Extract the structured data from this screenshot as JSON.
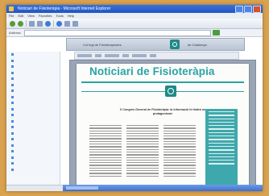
{
  "window": {
    "title": "Noticiari de Fisioteràpia - Microsoft Internet Explorer"
  },
  "menu": [
    "File",
    "Edit",
    "View",
    "Favorites",
    "Tools",
    "Help"
  ],
  "address": {
    "label": "Address"
  },
  "site_banner": {
    "left_text": "Col·legi de Fisioterapeutes",
    "right_text": "de Catalunya"
  },
  "sidebar": {
    "item_count_visible": 20,
    "accent": "#2d5aa8"
  },
  "newsletter": {
    "masthead": "Noticiari de Fisioteràpia",
    "headline": "X Congrés General de Fisioteràpia: la informació hi tindrà un protagonisme",
    "accent": "#2aa3a6"
  },
  "colors": {
    "background": "#d9a24f",
    "titlebar": "#1f55c2",
    "teal": "#2aa3a6"
  },
  "icons": [
    "browser-icon",
    "back-icon",
    "forward-icon",
    "stop-icon",
    "refresh-icon",
    "home-icon",
    "search-icon",
    "go-icon",
    "logo-icon"
  ]
}
